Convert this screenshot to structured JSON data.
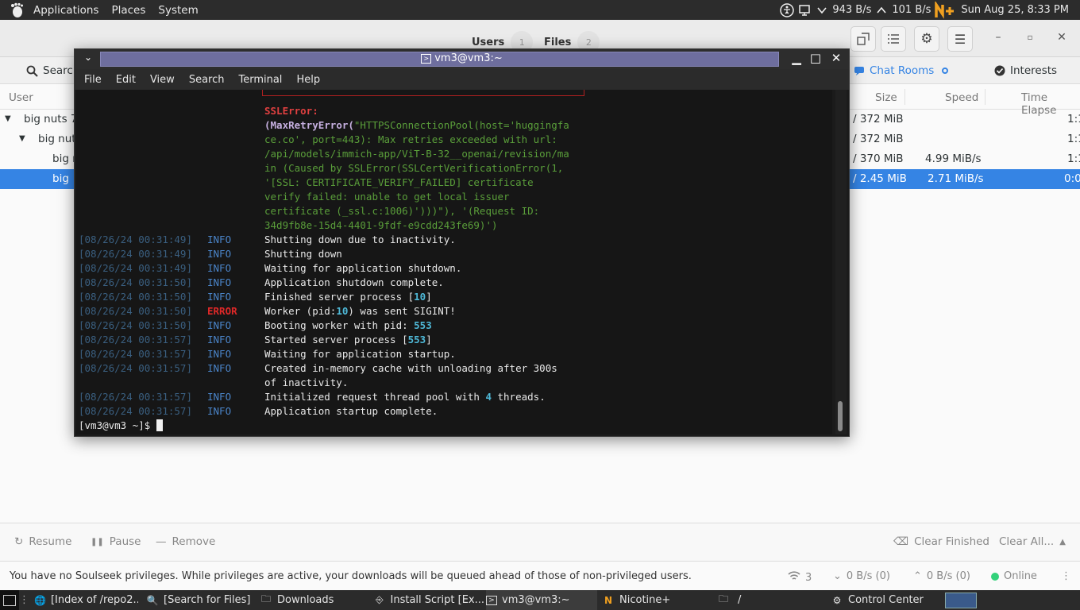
{
  "top_panel": {
    "menus": [
      "Applications",
      "Places",
      "System"
    ],
    "net_down": "943 B/s",
    "net_up": "101 B/s",
    "datetime": "Sun Aug 25, 8:33 PM"
  },
  "nicotine": {
    "tabs": [
      {
        "label": "Users",
        "count": "1"
      },
      {
        "label": "Files",
        "count": "2"
      }
    ],
    "toolbar": {
      "search": "Search",
      "chat_rooms": "Chat Rooms",
      "interests": "Interests"
    },
    "columns": {
      "user": "User",
      "size": "Size",
      "speed": "Speed",
      "time_elapsed": "Time Elapse"
    },
    "rows": [
      {
        "user": "big nuts 70",
        "size": "/ 372 MiB",
        "speed": "",
        "time": "1:1"
      },
      {
        "user": "big nut",
        "size": "/ 372 MiB",
        "speed": "",
        "time": "1:1"
      },
      {
        "user": "big r",
        "size": "/ 370 MiB",
        "speed": "4.99 MiB/s",
        "time": "1:1"
      },
      {
        "user": "big",
        "size": "/ 2.45 MiB",
        "speed": "2.71 MiB/s",
        "time": "0:0"
      }
    ],
    "bottom_actions": {
      "resume": "Resume",
      "pause": "Pause",
      "remove": "Remove",
      "clear_finished": "Clear Finished",
      "clear_all": "Clear All..."
    },
    "status": {
      "message": "You have no Soulseek privileges. While privileges are active, your downloads will be queued ahead of those of non-privileged users.",
      "connections": "3",
      "down": "0 B/s (0)",
      "up": "0 B/s (0)",
      "online": "Online"
    }
  },
  "terminal": {
    "title": "vm3@vm3:~",
    "menu": [
      "File",
      "Edit",
      "View",
      "Search",
      "Terminal",
      "Help"
    ],
    "ssl_label": "SSLError:",
    "error_lines": [
      "ce.co', port=443): Max retries exceeded with url:",
      "/api/models/immich-app/ViT-B-32__openai/revision/ma",
      "in (Caused by SSLError(SSLCertVerificationError(1,",
      "'[SSL: CERTIFICATE_VERIFY_FAILED] certificate",
      "verify failed: unable to get local issuer",
      "certificate (_ssl.c:1006)')))\"), '(Request ID:",
      "34d9fb8e-15d4-4401-9fdf-e9cdd243fe69)')"
    ],
    "error_first": {
      "open": "(",
      "name": "MaxRetryError",
      "paren": "(",
      "rest": "\"HTTPSConnectionPool(host='huggingfa"
    },
    "log": [
      {
        "ts": "[08/26/24 00:31:49]",
        "level": "INFO",
        "msg": "Shutting down due to inactivity."
      },
      {
        "ts": "[08/26/24 00:31:49]",
        "level": "INFO",
        "msg": "Shutting down"
      },
      {
        "ts": "[08/26/24 00:31:49]",
        "level": "INFO",
        "msg": "Waiting for application shutdown."
      },
      {
        "ts": "[08/26/24 00:31:50]",
        "level": "INFO",
        "msg": "Application shutdown complete."
      },
      {
        "ts": "[08/26/24 00:31:50]",
        "level": "INFO",
        "msg": "Finished server process [10]"
      },
      {
        "ts": "[08/26/24 00:31:50]",
        "level": "ERROR",
        "msg": "Worker (pid:10) was sent SIGINT!"
      },
      {
        "ts": "[08/26/24 00:31:50]",
        "level": "INFO",
        "msg": "Booting worker with pid: 553"
      },
      {
        "ts": "[08/26/24 00:31:57]",
        "level": "INFO",
        "msg": "Started server process [553]"
      },
      {
        "ts": "[08/26/24 00:31:57]",
        "level": "INFO",
        "msg": "Waiting for application startup."
      },
      {
        "ts": "[08/26/24 00:31:57]",
        "level": "INFO",
        "msg": "Created in-memory cache with unloading after 300s"
      },
      {
        "ts": "",
        "level": "",
        "msg": "of inactivity."
      },
      {
        "ts": "[08/26/24 00:31:57]",
        "level": "INFO",
        "msg": "Initialized request thread pool with 4 threads."
      },
      {
        "ts": "[08/26/24 00:31:57]",
        "level": "INFO",
        "msg": "Application startup complete."
      }
    ],
    "prompt": "[vm3@vm3 ~]$ "
  },
  "taskbar": {
    "tasks": [
      {
        "label": "[Index of /repo2...",
        "icon": "browser-icon"
      },
      {
        "label": "[Search for Files]",
        "icon": "search-files-icon"
      },
      {
        "label": "Downloads",
        "icon": "folder-icon"
      },
      {
        "label": "Install Script [Ex...",
        "icon": "script-icon"
      },
      {
        "label": "vm3@vm3:~",
        "icon": "terminal-icon"
      },
      {
        "label": "Nicotine+",
        "icon": "nicotine-icon"
      },
      {
        "label": "/",
        "icon": "folder-icon"
      },
      {
        "label": "Control Center",
        "icon": "control-center-icon"
      }
    ]
  },
  "colors": {
    "panel": "#2c2c2c",
    "selection": "#3584e4",
    "terminal_bg": "#161616",
    "error_red": "#e02828",
    "info_blue": "#4a84c8",
    "chat_rooms_blue": "#3584e4"
  }
}
